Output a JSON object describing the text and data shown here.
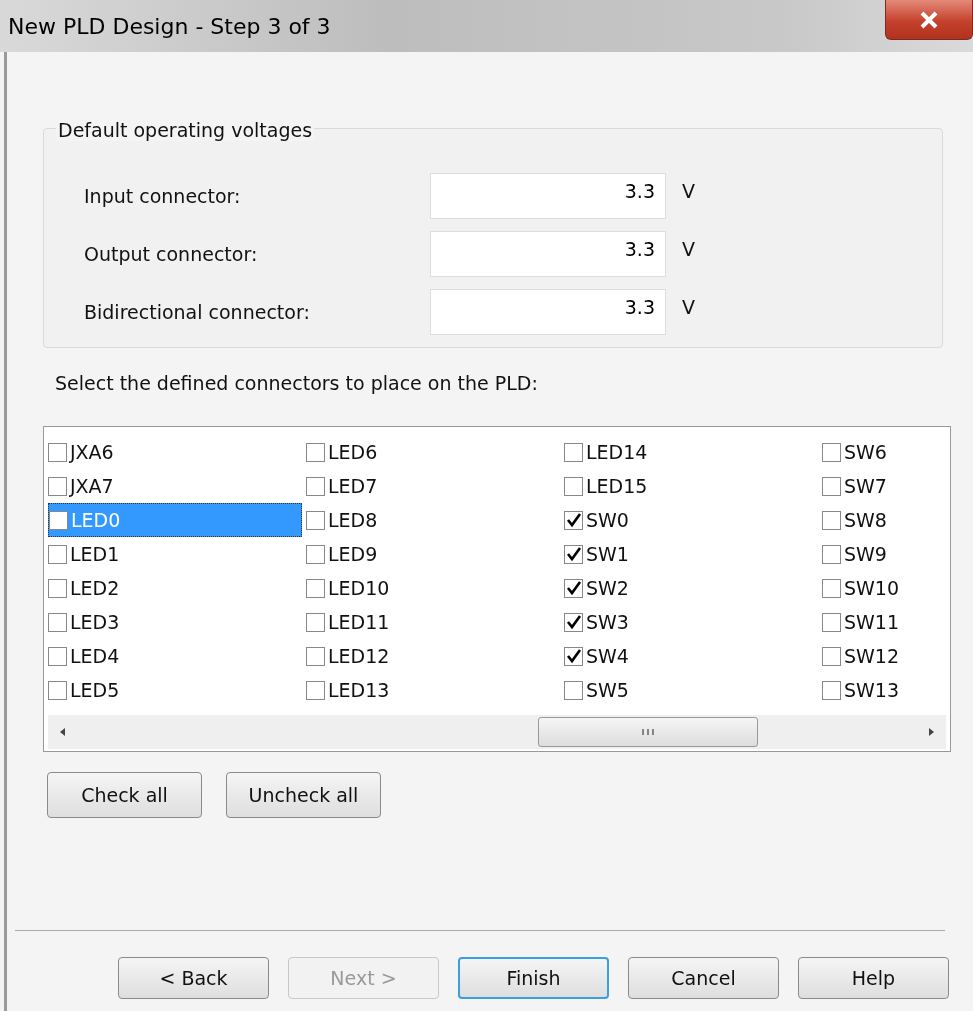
{
  "window": {
    "title": "New PLD Design - Step 3 of 3"
  },
  "voltages": {
    "title": "Default operating voltages",
    "fields": [
      {
        "label": "Input connector:",
        "value": "3.3",
        "unit": "V"
      },
      {
        "label": "Output connector:",
        "value": "3.3",
        "unit": "V"
      },
      {
        "label": "Bidirectional connector:",
        "value": "3.3",
        "unit": "V"
      }
    ]
  },
  "connectors_label": "Select the defined connectors to place on the PLD:",
  "connector_columns": [
    [
      {
        "label": "JXA6",
        "checked": false,
        "selected": false
      },
      {
        "label": "JXA7",
        "checked": false,
        "selected": false
      },
      {
        "label": "LED0",
        "checked": false,
        "selected": true
      },
      {
        "label": "LED1",
        "checked": false,
        "selected": false
      },
      {
        "label": "LED2",
        "checked": false,
        "selected": false
      },
      {
        "label": "LED3",
        "checked": false,
        "selected": false
      },
      {
        "label": "LED4",
        "checked": false,
        "selected": false
      },
      {
        "label": "LED5",
        "checked": false,
        "selected": false
      }
    ],
    [
      {
        "label": "LED6",
        "checked": false,
        "selected": false
      },
      {
        "label": "LED7",
        "checked": false,
        "selected": false
      },
      {
        "label": "LED8",
        "checked": false,
        "selected": false
      },
      {
        "label": "LED9",
        "checked": false,
        "selected": false
      },
      {
        "label": "LED10",
        "checked": false,
        "selected": false
      },
      {
        "label": "LED11",
        "checked": false,
        "selected": false
      },
      {
        "label": "LED12",
        "checked": false,
        "selected": false
      },
      {
        "label": "LED13",
        "checked": false,
        "selected": false
      }
    ],
    [
      {
        "label": "LED14",
        "checked": false,
        "selected": false
      },
      {
        "label": "LED15",
        "checked": false,
        "selected": false
      },
      {
        "label": "SW0",
        "checked": true,
        "selected": false
      },
      {
        "label": "SW1",
        "checked": true,
        "selected": false
      },
      {
        "label": "SW2",
        "checked": true,
        "selected": false
      },
      {
        "label": "SW3",
        "checked": true,
        "selected": false
      },
      {
        "label": "SW4",
        "checked": true,
        "selected": false
      },
      {
        "label": "SW5",
        "checked": false,
        "selected": false
      }
    ],
    [
      {
        "label": "SW6",
        "checked": false,
        "selected": false
      },
      {
        "label": "SW7",
        "checked": false,
        "selected": false
      },
      {
        "label": "SW8",
        "checked": false,
        "selected": false
      },
      {
        "label": "SW9",
        "checked": false,
        "selected": false
      },
      {
        "label": "SW10",
        "checked": false,
        "selected": false
      },
      {
        "label": "SW11",
        "checked": false,
        "selected": false
      },
      {
        "label": "SW12",
        "checked": false,
        "selected": false
      },
      {
        "label": "SW13",
        "checked": false,
        "selected": false
      }
    ]
  ],
  "list_buttons": [
    "Check all",
    "Uncheck all"
  ],
  "footer_buttons": [
    {
      "label": "< Back",
      "disabled": false,
      "default": false
    },
    {
      "label": "Next >",
      "disabled": true,
      "default": false
    },
    {
      "label": "Finish",
      "disabled": false,
      "default": true
    },
    {
      "label": "Cancel",
      "disabled": false,
      "default": false
    },
    {
      "label": "Help",
      "disabled": false,
      "default": false
    }
  ]
}
